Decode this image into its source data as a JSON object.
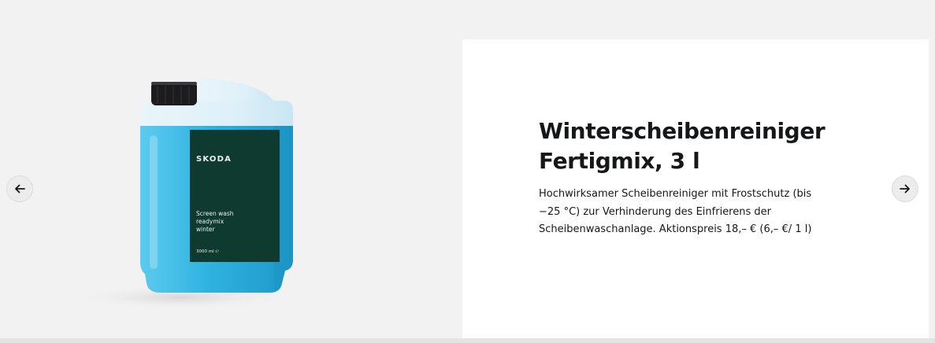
{
  "carousel": {
    "prev_icon": "arrow-left-icon",
    "next_icon": "arrow-right-icon"
  },
  "product": {
    "title_line1": "Winterscheibenreiniger",
    "title_line2": "Fertigmix, 3 l",
    "description": "Hochwirksamer Scheibenreiniger mit Frostschutz (bis −25 °C) zur Verhinderung des Einfrierens der Scheibenwaschanlage. Aktionspreis 18,– € (6,– €/ 1 l)",
    "label": {
      "brand": "SKODA",
      "line1": "Screen wash",
      "line2": "readymix",
      "line3": "winter",
      "volume": "3000 ml ℮"
    }
  },
  "colors": {
    "page_bg": "#f2f2f2",
    "card_bg": "#ffffff",
    "text": "#161718",
    "label_green": "#0e3a2f",
    "fluid_blue": "#2fb4e0"
  }
}
